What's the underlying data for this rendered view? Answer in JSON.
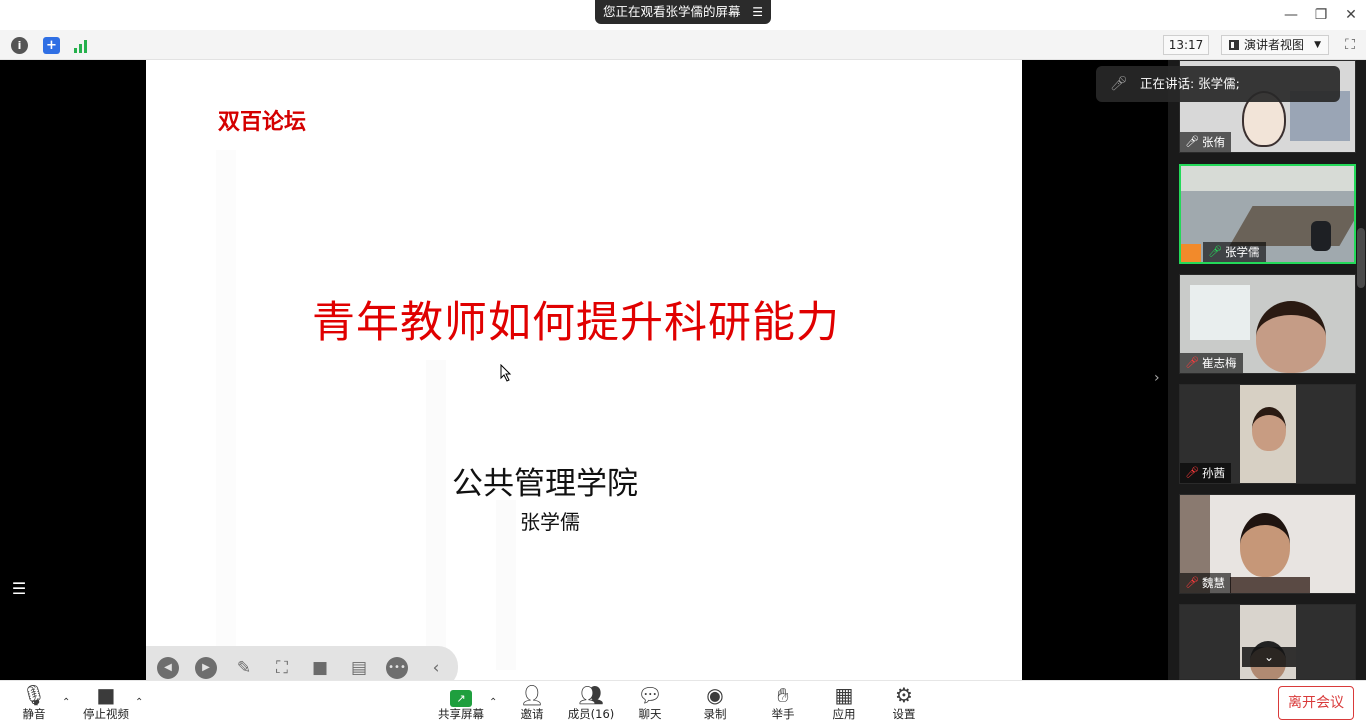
{
  "banner": {
    "text": "您正在观看张学儒的屏幕",
    "menu_icon": "list-menu-icon"
  },
  "window": {
    "minimize": "—",
    "restore": "❐",
    "close": "✕"
  },
  "toolbar": {
    "time": "13:17",
    "view_label": "演讲者视图"
  },
  "slide": {
    "tag": "双百论坛",
    "title": "青年教师如何提升科研能力",
    "org": "公共管理学院",
    "author": "张学儒"
  },
  "speaking": {
    "text": "正在讲话: 张学儒;"
  },
  "participants": [
    {
      "name": "张侑",
      "muted": false,
      "active": false
    },
    {
      "name": "张学儒",
      "muted": false,
      "active": true
    },
    {
      "name": "崔志梅",
      "muted": true,
      "active": false
    },
    {
      "name": "孙茜",
      "muted": true,
      "active": false
    },
    {
      "name": "魏慧",
      "muted": true,
      "active": false
    }
  ],
  "bottom": {
    "mute": "静音",
    "stop_video": "停止视频",
    "share": "共享屏幕",
    "invite": "邀请",
    "members": "成员(16)",
    "chat": "聊天",
    "record": "录制",
    "raise_hand": "举手",
    "apps": "应用",
    "settings": "设置",
    "leave": "离开会议"
  },
  "colors": {
    "accent_green": "#23d959",
    "title_red": "#e00000",
    "leave_red": "#d93a3a"
  }
}
